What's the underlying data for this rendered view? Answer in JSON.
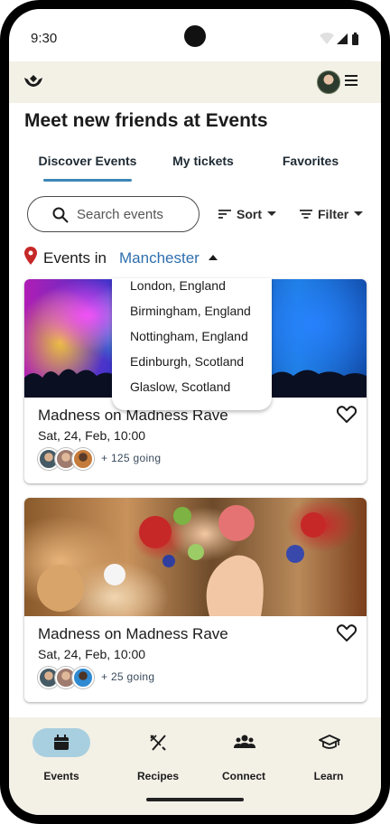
{
  "status_bar": {
    "time": "9:30"
  },
  "header": {
    "title": "Meet new friends at Events"
  },
  "tabs": [
    {
      "label": "Discover Events",
      "active": true
    },
    {
      "label": "My tickets",
      "active": false
    },
    {
      "label": "Favorites",
      "active": false
    }
  ],
  "search": {
    "placeholder": "Search events"
  },
  "controls": {
    "sort_label": "Sort",
    "filter_label": "Filter"
  },
  "location": {
    "prefix": "Events in",
    "selected": "Manchester",
    "options": [
      "London, England",
      "Birmingham, England",
      "Nottingham, England",
      "Edinburgh, Scotland",
      "Glaslow, Scotland"
    ]
  },
  "events": [
    {
      "title": "Madness on Madness Rave",
      "date": "Sat, 24, Feb, 10:00",
      "going": "+ 125 going",
      "image": "rave concert crowd"
    },
    {
      "title": "Madness on Madness Rave",
      "date": "Sat, 24, Feb, 10:00",
      "going": "+ 25 going",
      "image": "food platter with fruit"
    }
  ],
  "bottom_nav": [
    {
      "label": "Events",
      "icon": "calendar-icon",
      "active": true
    },
    {
      "label": "Recipes",
      "icon": "utensils-icon",
      "active": false
    },
    {
      "label": "Connect",
      "icon": "people-icon",
      "active": false
    },
    {
      "label": "Learn",
      "icon": "graduation-cap-icon",
      "active": false
    }
  ],
  "colors": {
    "accent": "#3d86b5",
    "link": "#2f6fae",
    "nav_active_pill": "#a8cfdf",
    "bar_bg": "#f3f0e6",
    "pin": "#c62828"
  }
}
